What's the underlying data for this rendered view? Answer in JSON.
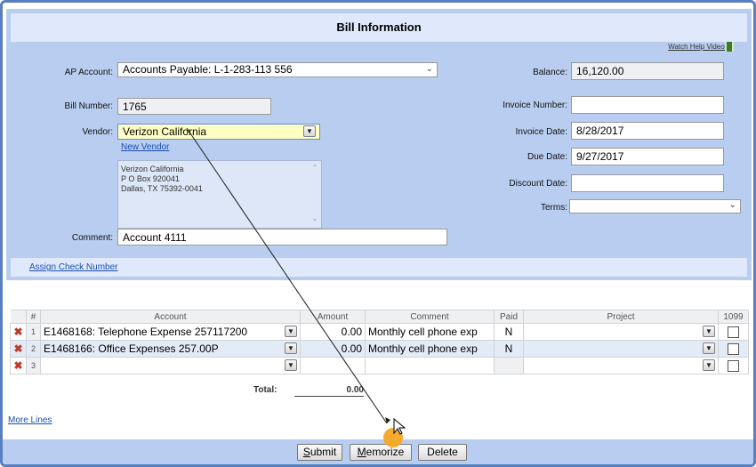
{
  "title": "Bill Information",
  "help_link": "Watch Help Video!",
  "labels": {
    "ap_account": "AP Account:",
    "bill_number": "Bill Number:",
    "vendor": "Vendor:",
    "comment": "Comment:",
    "balance": "Balance:",
    "invoice_number": "Invoice Number:",
    "invoice_date": "Invoice Date:",
    "due_date": "Due Date:",
    "discount_date": "Discount Date:",
    "terms": "Terms:"
  },
  "values": {
    "ap_account": "Accounts Payable: L-1-283-113 556",
    "bill_number": "1765",
    "vendor": "Verizon California",
    "comment": "Account 4111",
    "balance": "16,120.00",
    "invoice_number": "",
    "invoice_date": "8/28/2017",
    "due_date": "9/27/2017",
    "discount_date": "",
    "terms": ""
  },
  "new_vendor_link": "New Vendor",
  "vendor_address": [
    "Verizon California",
    "P O Box 920041",
    "Dallas, TX 75392-0041"
  ],
  "assign_check_link": "Assign Check Number",
  "table": {
    "headers": [
      "#",
      "Account",
      "Amount",
      "Comment",
      "Paid",
      "Project",
      "1099"
    ],
    "rows": [
      {
        "num": "1",
        "account": "E1468168: Telephone Expense 257117200",
        "amount": "0.00",
        "comment": "Monthly cell phone exp",
        "paid": "N",
        "project": ""
      },
      {
        "num": "2",
        "account": "E1468166: Office Expenses 257.00P",
        "amount": "0.00",
        "comment": "Monthly cell phone exp",
        "paid": "N",
        "project": ""
      },
      {
        "num": "3",
        "account": "",
        "amount": "",
        "comment": "",
        "paid": "",
        "project": ""
      }
    ]
  },
  "total_label": "Total:",
  "total_value": "0.00",
  "more_lines_link": "More Lines",
  "buttons": {
    "submit_first": "S",
    "submit_rest": "ubmit",
    "memorize_first": "M",
    "memorize_rest": "emorize",
    "delete": "Delete"
  },
  "colors": {
    "panel": "#b8cdef",
    "frame": "#5a7fc0",
    "vendor_highlight": "#ffffc4"
  }
}
